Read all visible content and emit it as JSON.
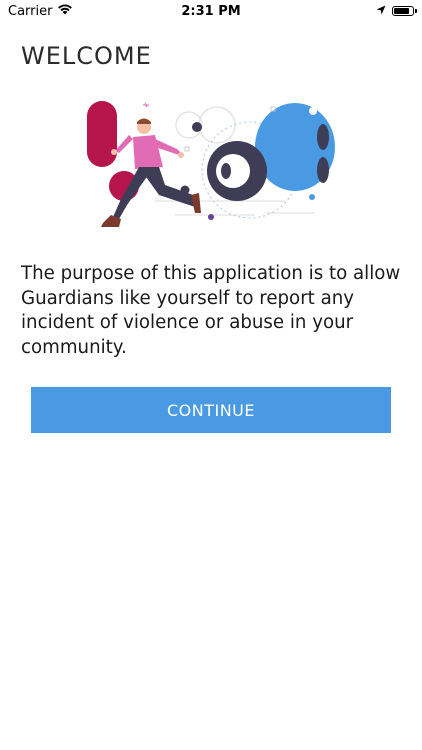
{
  "status_bar": {
    "carrier": "Carrier",
    "time": "2:31 PM",
    "icons": [
      "wifi-icon",
      "location-arrow-icon",
      "battery-icon"
    ],
    "battery_level": 0.9
  },
  "welcome": {
    "title": "WELCOME",
    "illustration": "person-running-from-camera-illustration",
    "description": "The purpose of this application is to allow Guardians like yourself to report any incident of violence or abuse in your community.",
    "continue_label": "CONTINUE"
  },
  "colors": {
    "accent": "#4a9ae3",
    "button_text": "#ffffff",
    "title_text": "#2b2b2b",
    "illustration_red": "#b5154b",
    "illustration_pink": "#e26bb5",
    "illustration_navy": "#3f3d56",
    "illustration_blue": "#4a9ae3"
  }
}
